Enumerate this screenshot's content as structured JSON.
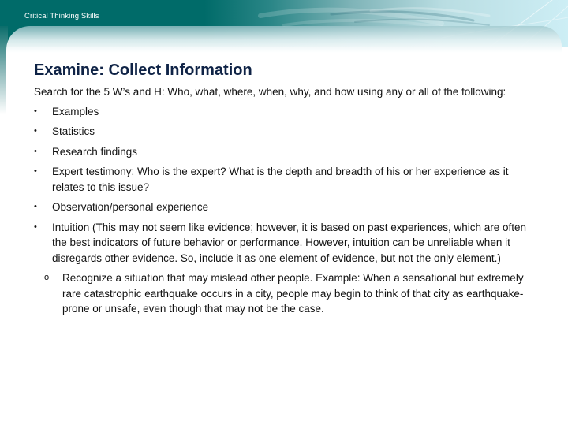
{
  "header": {
    "title": "Critical Thinking Skills",
    "colors": {
      "teal": "#006b69",
      "light_cyan": "#cdeef5"
    }
  },
  "slide": {
    "title": "Examine: Collect Information",
    "title_color": "#0f2346",
    "intro": "Search for the 5 W’s and H: Who, what, where, when, why, and how using any or all of the following:",
    "bullet_icon": "bullet-dot-icon",
    "sub_bullet_icon": "hollow-circle-icon",
    "bullets": [
      {
        "text": "Examples"
      },
      {
        "text": "Statistics"
      },
      {
        "text": "Research findings"
      },
      {
        "text": "Expert testimony: Who is the expert? What is the depth and breadth of his or her experience as it relates to this issue?"
      },
      {
        "text": "Observation/personal experience"
      },
      {
        "text": "Intuition (This may not seem like evidence; however, it is based on past experiences, which are often the best indicators of future behavior or performance. However, intuition can be unreliable when it disregards other evidence. So, include it as one element of evidence, but not the only element.)"
      }
    ],
    "sub_bullets": [
      {
        "text": "Recognize a situation that may mislead other people. Example: When a sensational but extremely rare catastrophic earthquake occurs in a city, people may begin to think of that city as earthquake-prone or unsafe, even though that may not be the case."
      }
    ]
  }
}
